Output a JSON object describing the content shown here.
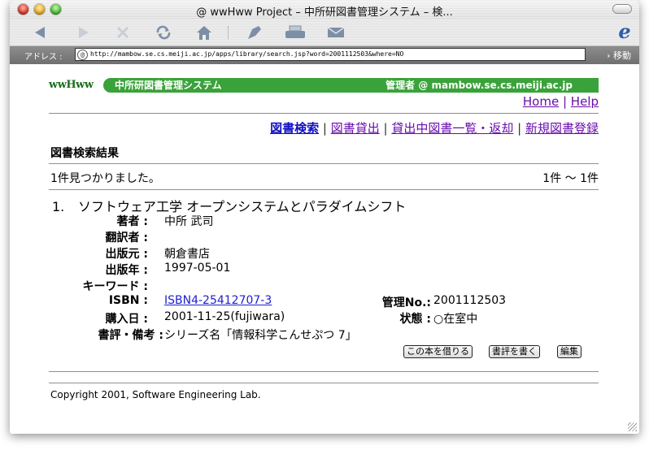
{
  "window": {
    "title": "@ wwHww Project – 中所研図書管理システム – 検..."
  },
  "toolbar": {
    "items": [
      "back-icon",
      "forward-icon",
      "stop-icon",
      "refresh-icon",
      "home-icon",
      "autofill-icon",
      "print-icon",
      "mail-icon"
    ]
  },
  "address": {
    "label": "アドレス :",
    "url": "http://mambow.se.cs.meiji.ac.jp/apps/library/search.jsp?word=2001112503&where=NO",
    "go": "› 移動"
  },
  "banner": {
    "logo": "wwHww",
    "system": "中所研図書管理システム",
    "admin": "管理者 @ mambow.se.cs.meiji.ac.jp"
  },
  "toplinks": {
    "home": "Home",
    "sep": "|",
    "help": "Help"
  },
  "nav": {
    "search": "図書検索",
    "lend": "図書貸出",
    "list": "貸出中図書一覧・返却",
    "register": "新規図書登録",
    "sep": "|"
  },
  "results": {
    "title": "図書検索結果",
    "found": "1件見つかりました。",
    "range": "1件 ～ 1件"
  },
  "book": {
    "num": "1.",
    "title": "ソフトウェア工学 オープンシステムとパラダイムシフト",
    "author_label": "著者 :",
    "author": "中所 武司",
    "translator_label": "翻訳者 :",
    "translator": "",
    "publisher_label": "出版元 :",
    "publisher": "朝倉書店",
    "year_label": "出版年 :",
    "year": "1997-05-01",
    "keyword_label": "キーワード :",
    "keyword": "",
    "isbn_label": "ISBN :",
    "isbn": "ISBN4-25412707-3",
    "mgmt_label": "管理No.:",
    "mgmt": "2001112503",
    "purchase_label": "購入日 :",
    "purchase": "2001-11-25(fujiwara)",
    "status_label": "状態 :",
    "status": "○在室中",
    "notes_label": "書評・備考 :",
    "notes": "シリーズ名「情報科学こんせぷつ 7」"
  },
  "buttons": {
    "borrow": "この本を借りる",
    "review": "書評を書く",
    "edit": "編集"
  },
  "footer": {
    "copyright": "Copyright 2001, Software Engineering Lab."
  }
}
